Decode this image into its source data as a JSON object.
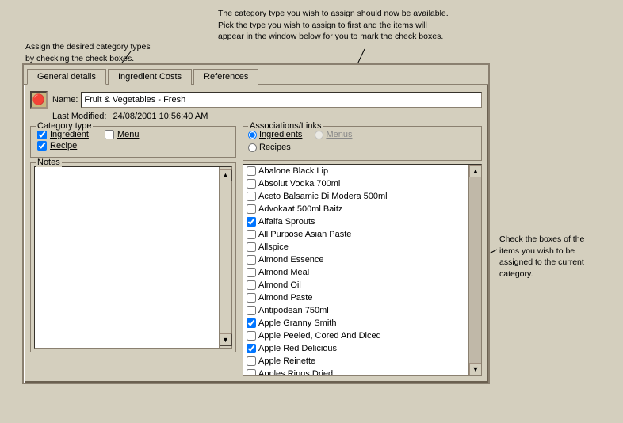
{
  "annotations": {
    "left": {
      "line1": "Assign the desired category types",
      "line2": "by checking the check boxes."
    },
    "top": {
      "line1": "The category type you wish to assign should now be available.",
      "line2": "Pick the type you wish to assign to first and the items will",
      "line3": "appear in the window below for you to mark the check boxes."
    },
    "right": {
      "line1": "Check the boxes of the",
      "line2": "items you wish to be",
      "line3": "assigned to the current",
      "line4": "category."
    }
  },
  "tabs": [
    {
      "label": "General details",
      "active": true
    },
    {
      "label": "Ingredient Costs",
      "active": false
    },
    {
      "label": "References",
      "active": false
    }
  ],
  "icon": "X",
  "name_label": "Name:",
  "name_value": "Fruit & Vegetables - Fresh",
  "modified_label": "Last Modified:",
  "modified_value": "24/08/2001 10:56:40 AM",
  "category_group_label": "Category type",
  "checkboxes": [
    {
      "label": "Ingredient",
      "checked": true
    },
    {
      "label": "Menu",
      "checked": false
    },
    {
      "label": "Recipe",
      "checked": true
    }
  ],
  "notes_label": "Notes",
  "assoc_label": "Associations/Links",
  "radios": [
    {
      "label": "Ingredients",
      "checked": true,
      "disabled": false
    },
    {
      "label": "Menus",
      "checked": false,
      "disabled": true
    },
    {
      "label": "Recipes",
      "checked": false,
      "disabled": false
    }
  ],
  "list_items": [
    {
      "label": "Abalone Black Lip",
      "checked": false
    },
    {
      "label": "Absolut Vodka 700ml",
      "checked": false
    },
    {
      "label": "Aceto Balsamic Di Modera 500ml",
      "checked": false
    },
    {
      "label": "Advokaat 500ml Baitz",
      "checked": false
    },
    {
      "label": "Alfalfa Sprouts",
      "checked": true
    },
    {
      "label": "All Purpose Asian Paste",
      "checked": false
    },
    {
      "label": "Allspice",
      "checked": false
    },
    {
      "label": "Almond Essence",
      "checked": false
    },
    {
      "label": "Almond Meal",
      "checked": false
    },
    {
      "label": "Almond Oil",
      "checked": false
    },
    {
      "label": "Almond Paste",
      "checked": false
    },
    {
      "label": "Antipodean 750ml",
      "checked": false
    },
    {
      "label": "Apple Granny Smith",
      "checked": true
    },
    {
      "label": "Apple Peeled, Cored And Diced",
      "checked": false
    },
    {
      "label": "Apple Red Delicious",
      "checked": true
    },
    {
      "label": "Apple Reinette",
      "checked": false
    },
    {
      "label": "Apples Rings Dried",
      "checked": false
    }
  ]
}
